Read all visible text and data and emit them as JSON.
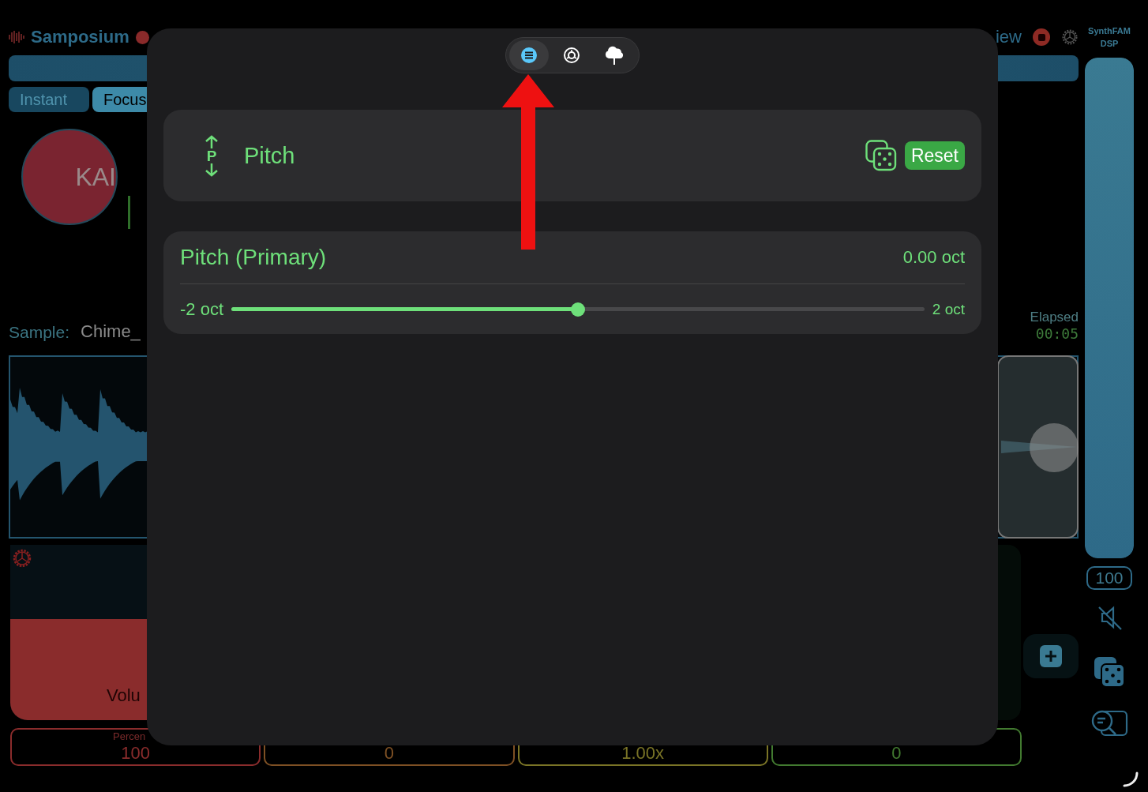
{
  "app": {
    "title": "Samposium",
    "view_label": "iew",
    "brand": [
      "SynthFAM",
      "DSP"
    ],
    "mode_tabs": [
      {
        "label": "Instant",
        "selected": false
      },
      {
        "label": "Focus",
        "selected": true
      }
    ],
    "pad_label": "KAI",
    "sample": {
      "label": "Sample:",
      "name": "Chime_"
    },
    "elapsed": {
      "label": "Elapsed",
      "time": "00:05"
    },
    "volume_pad_label": "Volu",
    "readouts": [
      {
        "caption": "Percen",
        "value": "100",
        "color": "#8a2c2c"
      },
      {
        "value": "0",
        "color": "#7e5024"
      },
      {
        "value": "1.00x",
        "color": "#7a7426"
      },
      {
        "value": "0",
        "color": "#427a30"
      }
    ],
    "master": {
      "level": 1,
      "value": "100"
    }
  },
  "sheet": {
    "tabs": [
      {
        "kind": "list",
        "selected": true
      },
      {
        "kind": "dial",
        "selected": false
      },
      {
        "kind": "tree",
        "selected": false
      }
    ],
    "header": {
      "icon_letter": "P",
      "title": "Pitch",
      "reset": "Reset"
    },
    "param": {
      "title": "Pitch (Primary)",
      "reading": "0.00 oct",
      "min": "-2 oct",
      "max": "2 oct",
      "level": 0.5
    }
  }
}
